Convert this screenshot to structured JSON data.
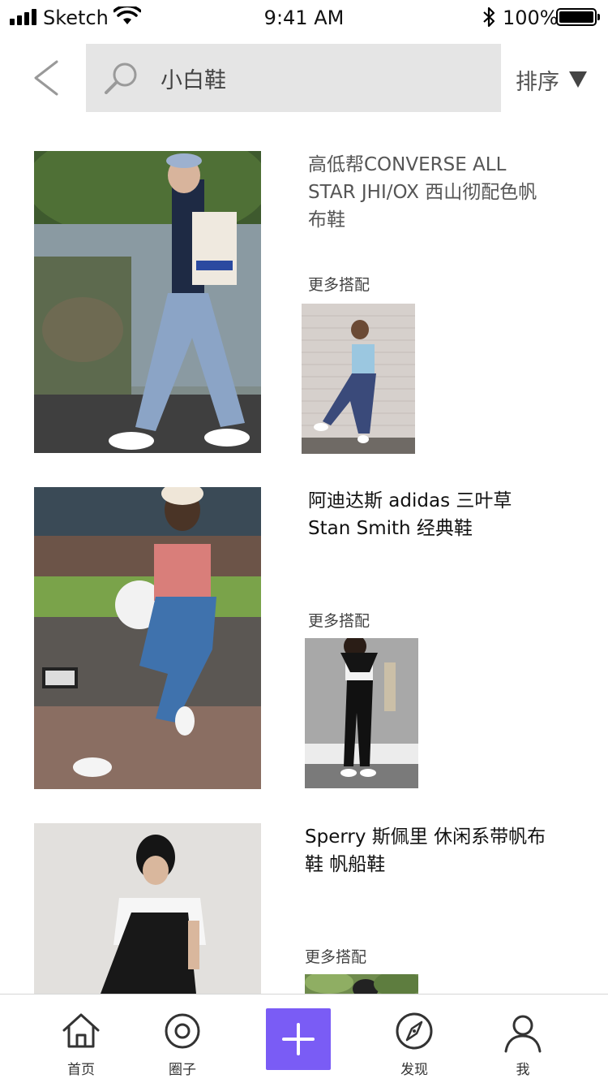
{
  "status_bar": {
    "carrier": "Sketch",
    "time": "9:41 AM",
    "battery": "100%"
  },
  "search": {
    "query": "小白鞋",
    "sort_label": "排序"
  },
  "products": [
    {
      "title": "高低帮CONVERSE ALL STAR JHI/OX 西山彻配色帆布鞋",
      "more_label": "更多搭配",
      "title_color": "#555555"
    },
    {
      "title": "阿迪达斯 adidas 三叶草 Stan Smith 经典鞋",
      "more_label": "更多搭配",
      "title_color": "#111111"
    },
    {
      "title": "Sperry 斯佩里 休闲系带帆布鞋 帆船鞋",
      "more_label": "更多搭配",
      "title_color": "#111111"
    }
  ],
  "tab_bar": {
    "tabs": [
      {
        "label": "首页",
        "icon": "home-icon"
      },
      {
        "label": "圈子",
        "icon": "circle-icon"
      },
      {
        "label": "发现",
        "icon": "compass-icon"
      },
      {
        "label": "我",
        "icon": "profile-icon"
      }
    ],
    "add_icon": "plus-icon",
    "accent_color": "#7a5cf5"
  }
}
